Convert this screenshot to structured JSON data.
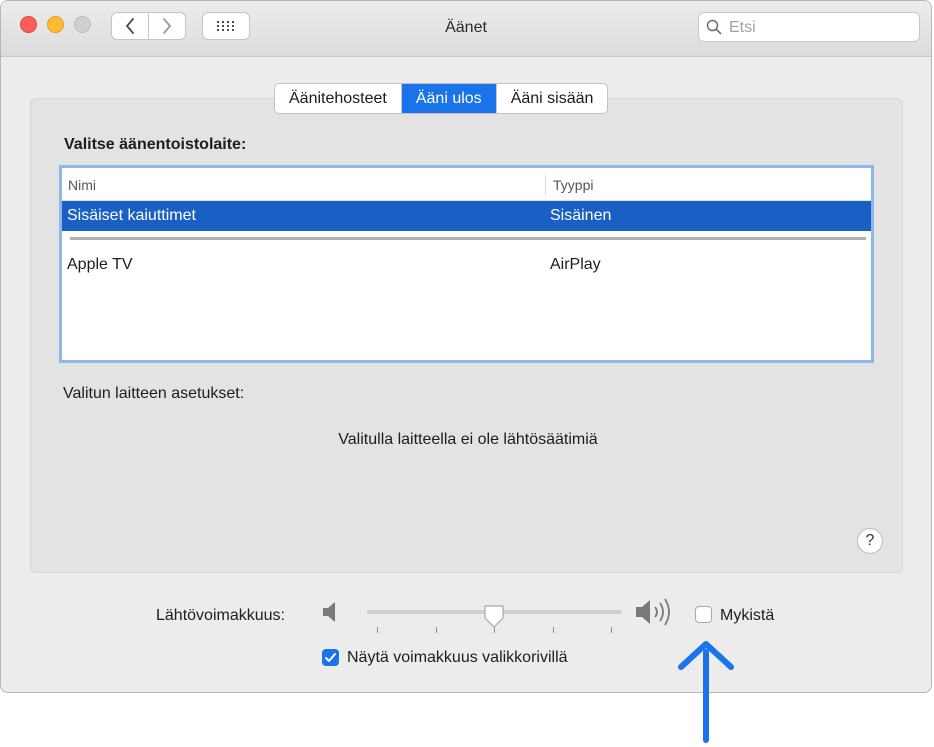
{
  "window": {
    "title": "Äänet",
    "search": {
      "placeholder": "Etsi",
      "value": ""
    }
  },
  "tabs": [
    {
      "label": "Äänitehosteet",
      "active": false
    },
    {
      "label": "Ääni ulos",
      "active": true
    },
    {
      "label": "Ääni sisään",
      "active": false
    }
  ],
  "output": {
    "section_label": "Valitse äänentoistolaite:",
    "columns": {
      "name": "Nimi",
      "type": "Tyyppi"
    },
    "devices": [
      {
        "name": "Sisäiset kaiuttimet",
        "type": "Sisäinen",
        "selected": true
      },
      {
        "name": "Apple TV",
        "type": "AirPlay",
        "selected": false
      }
    ],
    "settings_label": "Valitun laitteen asetukset:",
    "no_controls_text": "Valitulla laitteella ei ole lähtösäätimiä",
    "help_label": "?"
  },
  "volume": {
    "label": "Lähtövoimakkuus:",
    "level": 0.5,
    "mute_label": "Mykistä",
    "mute_checked": false,
    "show_in_menubar_label": "Näytä voimakkuus valikkorivillä",
    "show_in_menubar_checked": true
  },
  "icons": {
    "speaker_low": "speaker-low-icon",
    "speaker_high": "speaker-high-icon",
    "search": "search-icon",
    "annotation_arrow": "arrow-up-icon"
  },
  "colors": {
    "accent": "#1a73e8",
    "selection": "#1a5fc4",
    "annotation": "#1a73e8"
  }
}
